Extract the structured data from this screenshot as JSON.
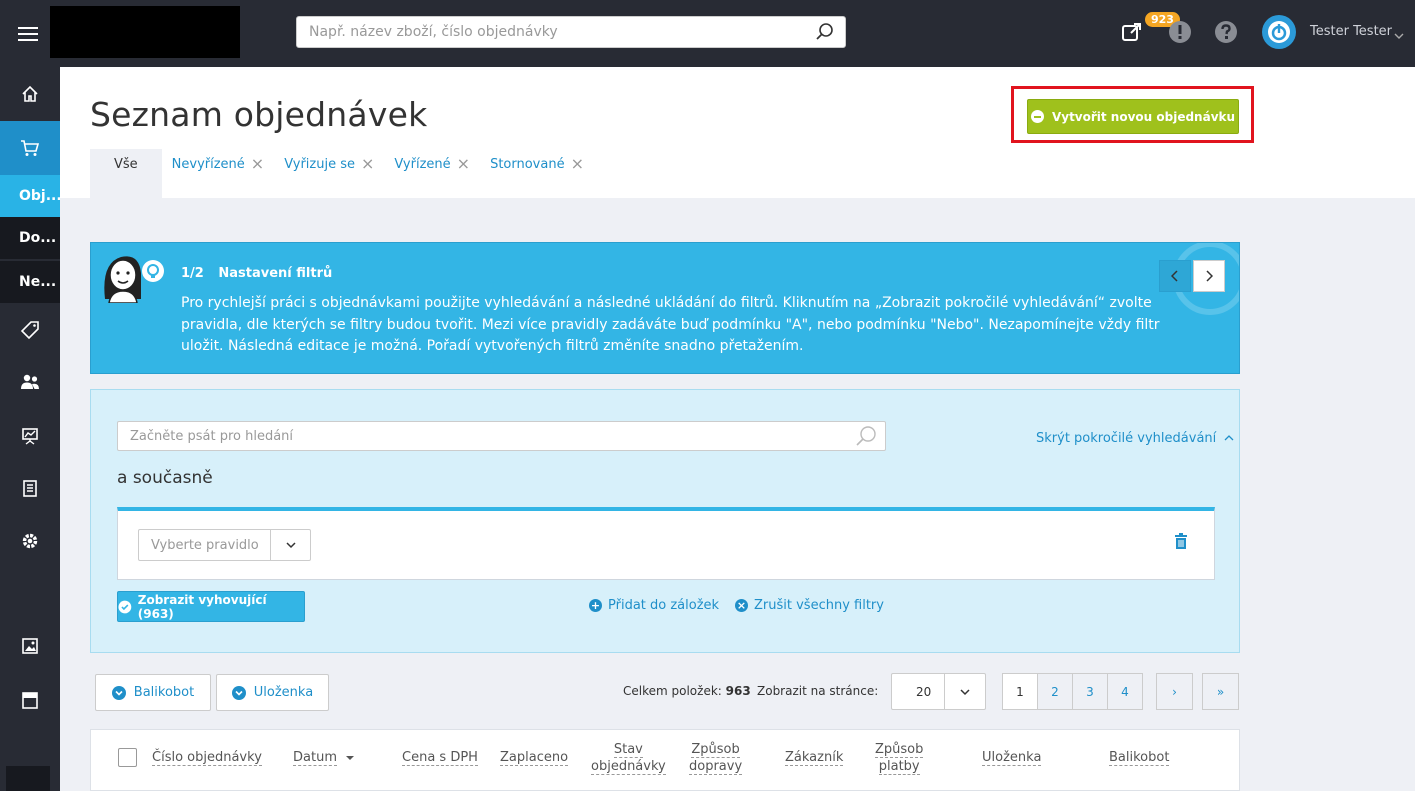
{
  "topbar": {
    "search_placeholder": "Např. název zboží, číslo objednávky",
    "notification_count": "923",
    "user_name": "Tester Tester"
  },
  "sidebar": {
    "items": [
      {
        "icon": "home-icon"
      },
      {
        "icon": "cart-icon",
        "active": true
      },
      {
        "icon": "tag-icon"
      },
      {
        "icon": "users-icon"
      },
      {
        "icon": "presentation-icon"
      },
      {
        "icon": "document-icon"
      },
      {
        "icon": "gear-icon"
      },
      {
        "icon": "image-icon"
      },
      {
        "icon": "store-icon"
      }
    ],
    "sub_items": [
      "Obj...",
      "Do...",
      "Ne..."
    ]
  },
  "header": {
    "title": "Seznam objednávek",
    "create_button": "Vytvořit novou objednávku",
    "tabs": [
      {
        "label": "Vše",
        "active": true
      },
      {
        "label": "Nevyřízené"
      },
      {
        "label": "Vyřizuje se"
      },
      {
        "label": "Vyřízené"
      },
      {
        "label": "Stornované"
      }
    ]
  },
  "banner": {
    "step": "1/2",
    "title": "Nastavení filtrů",
    "text": "Pro rychlejší práci s objednávkami použijte vyhledávání a následné ukládání do filtrů. Kliknutím na „Zobrazit pokročilé vyhledávání“ zvolte pravidla, dle kterých se filtry budou tvořit. Mezi více pravidly zadáváte buď podmínku \"A\", nebo podmínku \"Nebo\". Nezapomínejte vždy filtr uložit. Následná editace je možná. Pořadí vytvořených filtrů změníte snadno přetažením."
  },
  "filter": {
    "search_placeholder": "Začněte psát pro hledání",
    "advanced_toggle": "Skrýt pokročilé vyhledávání",
    "and_label": "a současně",
    "rule_placeholder": "Vyberte pravidlo",
    "show_button": "Zobrazit vyhovující (963)",
    "add_bookmark": "Přidat do záložek",
    "clear_filters": "Zrušit všechny filtry"
  },
  "toolbar": {
    "balikobot": "Balikobot",
    "ulozenka": "Uloženka",
    "total_label": "Celkem položek:",
    "total_value": "963",
    "per_page_label": "Zobrazit na stránce:",
    "per_page_value": "20",
    "pages": [
      "1",
      "2",
      "3",
      "4"
    ],
    "next": "›",
    "last": "»"
  },
  "table": {
    "columns": [
      [
        "Číslo objednávky"
      ],
      [
        "Datum"
      ],
      [
        "Cena s DPH"
      ],
      [
        "Zaplaceno"
      ],
      [
        "Stav",
        "objednávky"
      ],
      [
        "Způsob",
        "dopravy"
      ],
      [
        "Zákazník"
      ],
      [
        "Způsob",
        "platby"
      ],
      [
        "Uloženka"
      ],
      [
        "Balikobot"
      ]
    ]
  },
  "colors": {
    "accent": "#1f8fc9",
    "banner": "#33b5e5",
    "create_button": "#9fc11c",
    "highlight_frame": "#e1141e",
    "badge": "#f5a623"
  }
}
